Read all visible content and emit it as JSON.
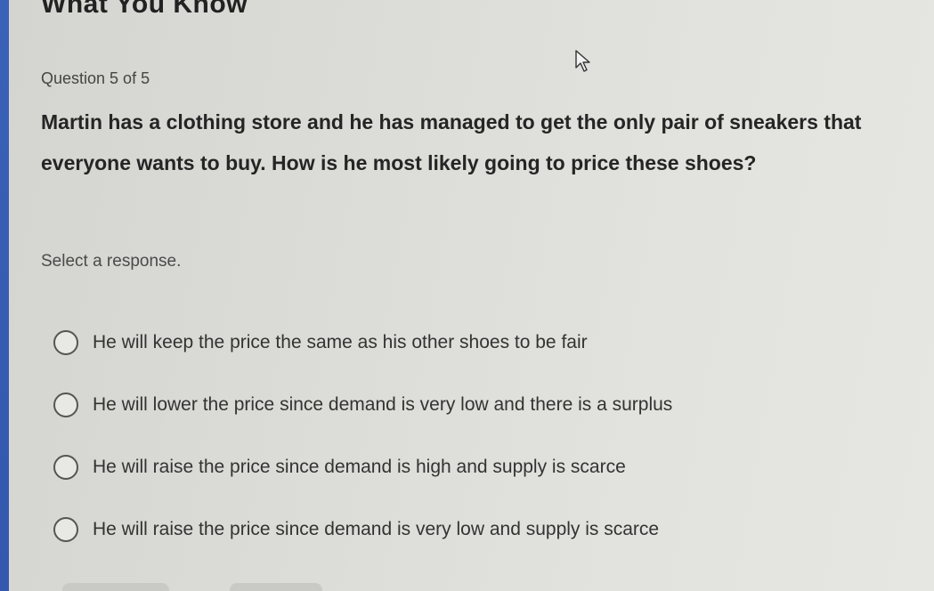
{
  "header": {
    "section_title": "What You Know",
    "question_counter": "Question 5 of 5"
  },
  "question": {
    "text": "Martin has a clothing store and he has managed to get the only pair of sneakers that everyone wants to buy. How is he most likely going to price these shoes?",
    "prompt": "Select a response."
  },
  "options": [
    {
      "label": "He will keep the price the same as his other shoes to be fair"
    },
    {
      "label": "He will lower the price since demand is very low and there is a surplus"
    },
    {
      "label": "He will raise the price since demand is high and supply is scarce"
    },
    {
      "label": "He will raise the price since demand is very low and supply is scarce"
    }
  ],
  "colors": {
    "left_accent": "#3a62b8",
    "background": "#dcdcd8",
    "text": "#252525"
  },
  "icons": {
    "cursor": "mouse-pointer-icon",
    "radio": "radio-button"
  }
}
